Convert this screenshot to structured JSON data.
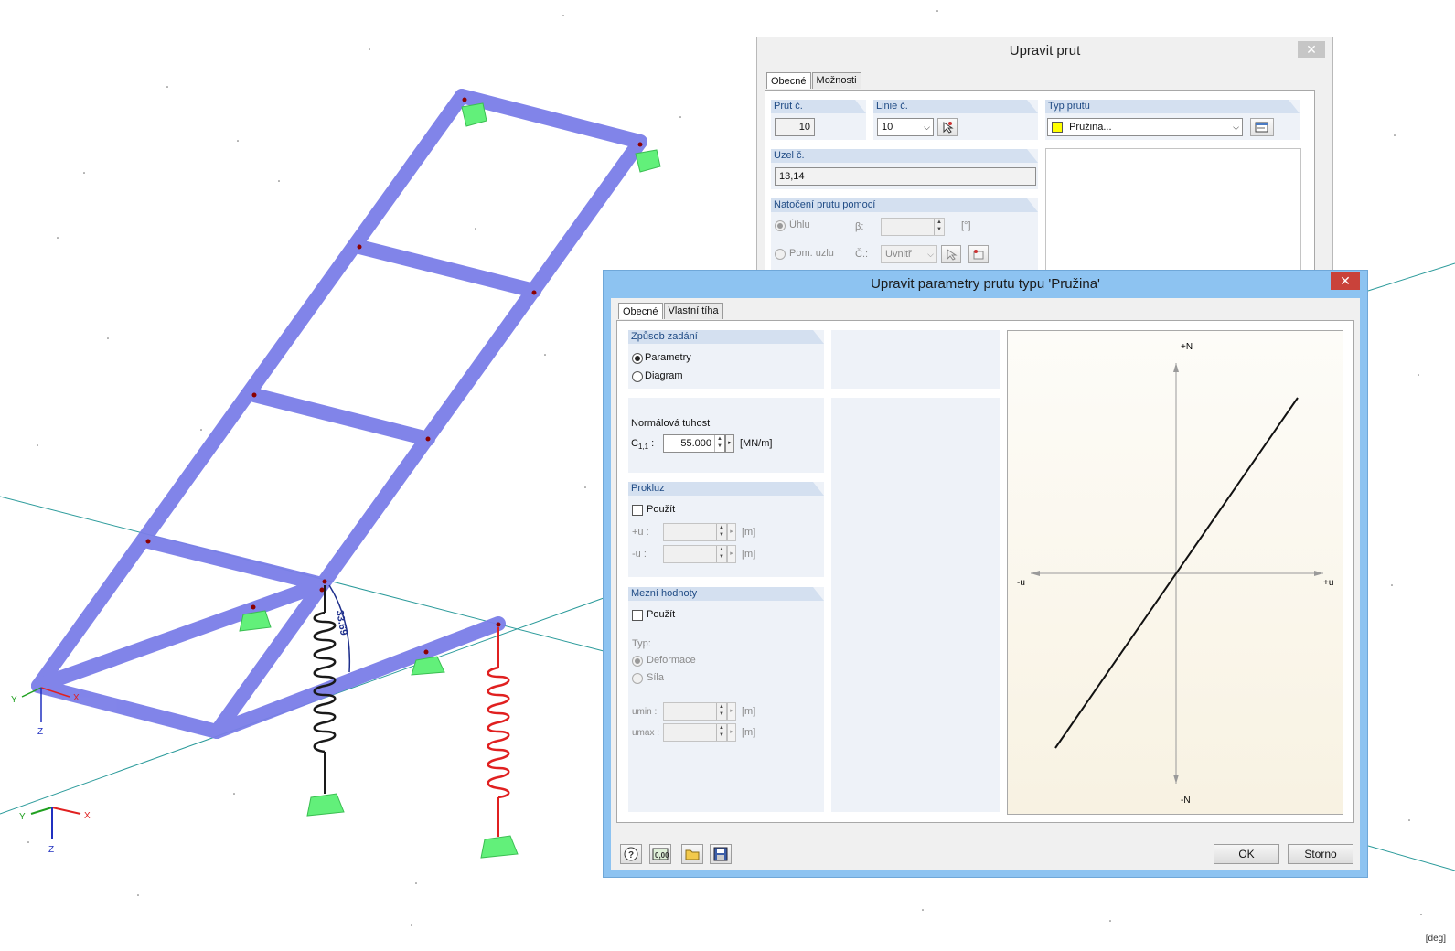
{
  "viewport": {
    "unit_label": "[deg]",
    "angle_annotation": "33.69",
    "axes_main": {
      "x": "X",
      "y": "Y",
      "z": "Z"
    },
    "axes_corner": {
      "x": "X",
      "y": "Y",
      "z": "Z"
    },
    "colors": {
      "member": "#7b7ee8",
      "support": "#62f07a",
      "spring_black": "#1a1a1a",
      "spring_red": "#e02020",
      "grid_line": "#2a9a9a"
    }
  },
  "edit_member_dialog": {
    "title": "Upravit prut",
    "tabs": [
      "Obecné",
      "Možnosti"
    ],
    "member_no": {
      "label": "Prut č.",
      "value": "10"
    },
    "line_no": {
      "label": "Linie č.",
      "value": "10"
    },
    "member_type": {
      "label": "Typ prutu",
      "value": "Pružina...",
      "swatch_color": "#ffff00"
    },
    "nodes": {
      "label": "Uzel č.",
      "value": "13,14"
    },
    "rotation": {
      "label": "Natočení prutu pomocí",
      "angle_option": "Úhlu",
      "beta_label": "β:",
      "beta_unit": "[°]",
      "node_option": "Pom. uzlu",
      "node_no_label": "Č.:",
      "node_select": "Uvnitř"
    }
  },
  "spring_dialog": {
    "title": "Upravit parametry prutu typu 'Pružina'",
    "tabs": [
      "Obecné",
      "Vlastní tíha"
    ],
    "input_mode": {
      "label": "Způsob zadání",
      "options": [
        "Parametry",
        "Diagram"
      ],
      "selected": "Parametry"
    },
    "stiffness": {
      "label": "Normálová tuhost",
      "symbol": "C",
      "subscript": "1,1",
      "value": "55.000",
      "unit": "[MN/m]"
    },
    "slip": {
      "label": "Prokluz",
      "use_label": "Použít",
      "plus_u_label": "+u :",
      "minus_u_label": "-u :",
      "unit": "[m]"
    },
    "limits": {
      "label": "Mezní hodnoty",
      "use_label": "Použít",
      "type_label": "Typ:",
      "type_options": [
        "Deformace",
        "Síla"
      ],
      "umin_label": "umin :",
      "umax_label": "umax :",
      "unit": "[m]"
    },
    "graph": {
      "plus_n": "+N",
      "minus_n": "-N",
      "plus_u": "+u",
      "minus_u": "-u"
    },
    "buttons": {
      "ok": "OK",
      "cancel": "Storno"
    },
    "tool_icons": [
      "help-icon",
      "units-icon",
      "open-folder-icon",
      "save-icon"
    ]
  }
}
